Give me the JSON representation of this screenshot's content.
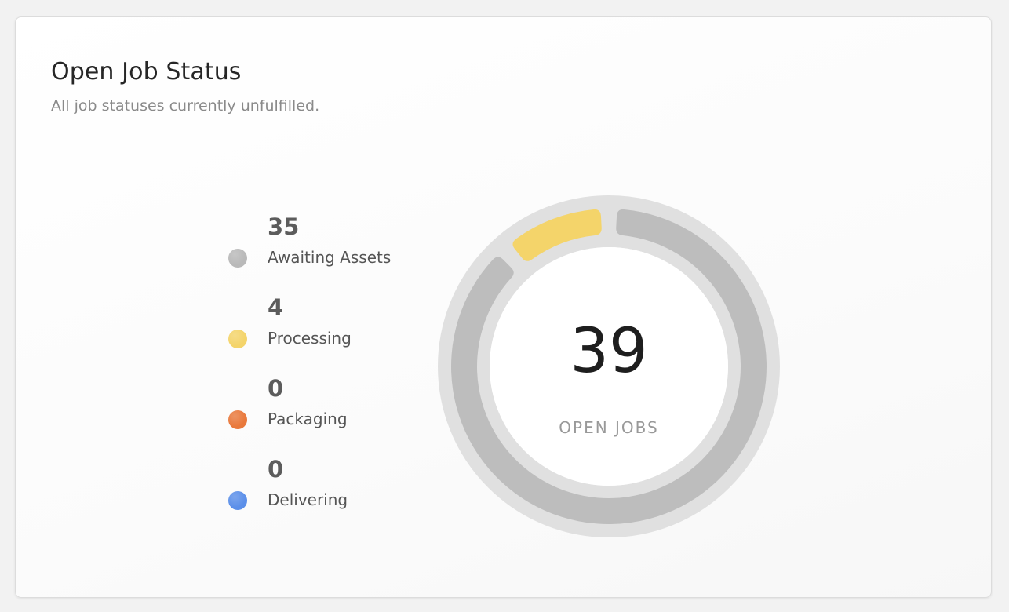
{
  "title": "Open Job Status",
  "subtitle": "All job statuses currently unfulfilled.",
  "center": {
    "value": "39",
    "label": "OPEN JOBS"
  },
  "chart_data": {
    "type": "donut",
    "title": "Open Job Status",
    "subtitle": "All job statuses currently unfulfilled.",
    "total": 39,
    "categories": [
      "Awaiting Assets",
      "Processing",
      "Packaging",
      "Delivering"
    ],
    "values": [
      35,
      4,
      0,
      0
    ],
    "colors": [
      "#b9b9b9",
      "#f4d46a",
      "#e9793c",
      "#5b8fe9"
    ],
    "segment_colors": [
      "#bdbdbd",
      "#f4d46a",
      "#e9793c",
      "#5b8fe9"
    ],
    "track_color": "#e0e0e0",
    "legend_position": "left",
    "center_label": "OPEN JOBS"
  },
  "legend": [
    {
      "value": "35",
      "label": "Awaiting Assets",
      "color": "#b9b9b9"
    },
    {
      "value": "4",
      "label": "Processing",
      "color": "#f4d46a"
    },
    {
      "value": "0",
      "label": "Packaging",
      "color": "#e9793c"
    },
    {
      "value": "0",
      "label": "Delivering",
      "color": "#5b8fe9"
    }
  ]
}
